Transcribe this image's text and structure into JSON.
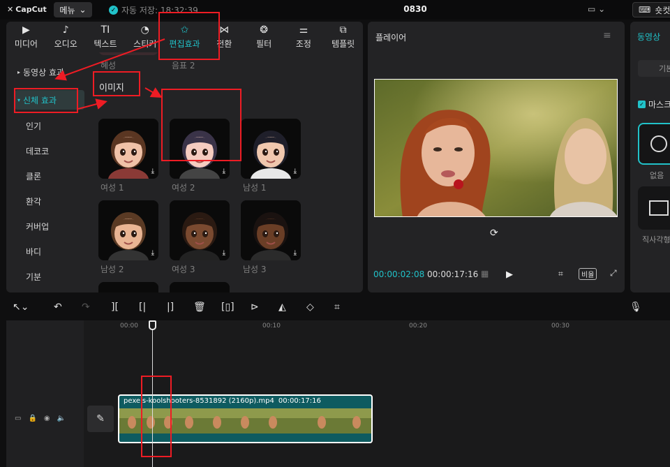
{
  "app": {
    "logo": "CapCut",
    "menu_label": "메뉴",
    "autosave": "자동 저장: 18:32:39",
    "project_title": "0830",
    "shortcut_label": "숏컷"
  },
  "tabs": [
    {
      "label": "미디어",
      "icon": "media-icon"
    },
    {
      "label": "오디오",
      "icon": "audio-icon"
    },
    {
      "label": "텍스트",
      "icon": "text-icon"
    },
    {
      "label": "스티커",
      "icon": "sticker-icon"
    },
    {
      "label": "편집효과",
      "icon": "effects-icon",
      "active": true
    },
    {
      "label": "전환",
      "icon": "transition-icon"
    },
    {
      "label": "필터",
      "icon": "filter-icon"
    },
    {
      "label": "조정",
      "icon": "adjust-icon"
    },
    {
      "label": "템플릿",
      "icon": "template-icon"
    }
  ],
  "categories": {
    "video_effects": "동영상 효과",
    "body_effects": "신체 효과",
    "items": [
      "인기",
      "데코코",
      "클론",
      "환각",
      "커버업",
      "바디",
      "기분"
    ]
  },
  "grid": {
    "top_captions": [
      "혜성",
      "음표 2"
    ],
    "section_title": "이미지",
    "avatars": [
      {
        "caption": "여성 1"
      },
      {
        "caption": "여성 2"
      },
      {
        "caption": "남성 1"
      },
      {
        "caption": "남성 2"
      },
      {
        "caption": "여성 3"
      },
      {
        "caption": "남성 3"
      }
    ]
  },
  "player": {
    "title": "플레이어",
    "current_time": "00:00:02:08",
    "total_time": "00:00:17:16",
    "ratio_label": "비율"
  },
  "right_panel": {
    "tab_label": "동영상",
    "basic_label": "기본",
    "mask_label": "마스크",
    "none_label": "없음",
    "rect_label": "직사각형"
  },
  "timeline": {
    "ruler_ticks": [
      "00:00",
      "00:10",
      "00:20",
      "00:30"
    ],
    "clip_name": "pexels-koolshooters-8531892 (2160p).mp4",
    "clip_duration": "00:00:17:16"
  },
  "colors": {
    "accent": "#21c2c9",
    "annotation": "#ee1c24",
    "clip_bg": "#0e5b60"
  }
}
